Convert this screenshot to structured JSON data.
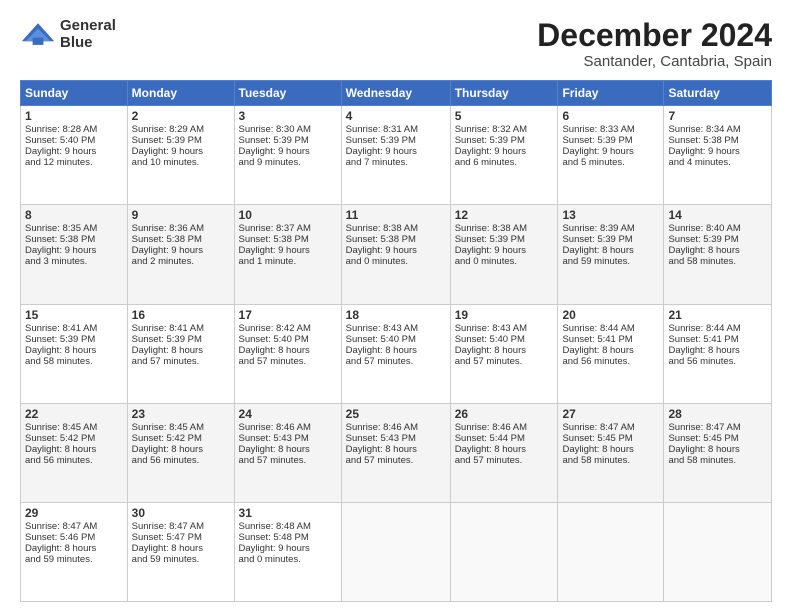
{
  "logo": {
    "name": "General",
    "name2": "Blue"
  },
  "header": {
    "title": "December 2024",
    "subtitle": "Santander, Cantabria, Spain"
  },
  "weekdays": [
    "Sunday",
    "Monday",
    "Tuesday",
    "Wednesday",
    "Thursday",
    "Friday",
    "Saturday"
  ],
  "weeks": [
    [
      {
        "day": "1",
        "lines": [
          "Sunrise: 8:28 AM",
          "Sunset: 5:40 PM",
          "Daylight: 9 hours",
          "and 12 minutes."
        ]
      },
      {
        "day": "2",
        "lines": [
          "Sunrise: 8:29 AM",
          "Sunset: 5:39 PM",
          "Daylight: 9 hours",
          "and 10 minutes."
        ]
      },
      {
        "day": "3",
        "lines": [
          "Sunrise: 8:30 AM",
          "Sunset: 5:39 PM",
          "Daylight: 9 hours",
          "and 9 minutes."
        ]
      },
      {
        "day": "4",
        "lines": [
          "Sunrise: 8:31 AM",
          "Sunset: 5:39 PM",
          "Daylight: 9 hours",
          "and 7 minutes."
        ]
      },
      {
        "day": "5",
        "lines": [
          "Sunrise: 8:32 AM",
          "Sunset: 5:39 PM",
          "Daylight: 9 hours",
          "and 6 minutes."
        ]
      },
      {
        "day": "6",
        "lines": [
          "Sunrise: 8:33 AM",
          "Sunset: 5:39 PM",
          "Daylight: 9 hours",
          "and 5 minutes."
        ]
      },
      {
        "day": "7",
        "lines": [
          "Sunrise: 8:34 AM",
          "Sunset: 5:38 PM",
          "Daylight: 9 hours",
          "and 4 minutes."
        ]
      }
    ],
    [
      {
        "day": "8",
        "lines": [
          "Sunrise: 8:35 AM",
          "Sunset: 5:38 PM",
          "Daylight: 9 hours",
          "and 3 minutes."
        ]
      },
      {
        "day": "9",
        "lines": [
          "Sunrise: 8:36 AM",
          "Sunset: 5:38 PM",
          "Daylight: 9 hours",
          "and 2 minutes."
        ]
      },
      {
        "day": "10",
        "lines": [
          "Sunrise: 8:37 AM",
          "Sunset: 5:38 PM",
          "Daylight: 9 hours",
          "and 1 minute."
        ]
      },
      {
        "day": "11",
        "lines": [
          "Sunrise: 8:38 AM",
          "Sunset: 5:38 PM",
          "Daylight: 9 hours",
          "and 0 minutes."
        ]
      },
      {
        "day": "12",
        "lines": [
          "Sunrise: 8:38 AM",
          "Sunset: 5:39 PM",
          "Daylight: 9 hours",
          "and 0 minutes."
        ]
      },
      {
        "day": "13",
        "lines": [
          "Sunrise: 8:39 AM",
          "Sunset: 5:39 PM",
          "Daylight: 8 hours",
          "and 59 minutes."
        ]
      },
      {
        "day": "14",
        "lines": [
          "Sunrise: 8:40 AM",
          "Sunset: 5:39 PM",
          "Daylight: 8 hours",
          "and 58 minutes."
        ]
      }
    ],
    [
      {
        "day": "15",
        "lines": [
          "Sunrise: 8:41 AM",
          "Sunset: 5:39 PM",
          "Daylight: 8 hours",
          "and 58 minutes."
        ]
      },
      {
        "day": "16",
        "lines": [
          "Sunrise: 8:41 AM",
          "Sunset: 5:39 PM",
          "Daylight: 8 hours",
          "and 57 minutes."
        ]
      },
      {
        "day": "17",
        "lines": [
          "Sunrise: 8:42 AM",
          "Sunset: 5:40 PM",
          "Daylight: 8 hours",
          "and 57 minutes."
        ]
      },
      {
        "day": "18",
        "lines": [
          "Sunrise: 8:43 AM",
          "Sunset: 5:40 PM",
          "Daylight: 8 hours",
          "and 57 minutes."
        ]
      },
      {
        "day": "19",
        "lines": [
          "Sunrise: 8:43 AM",
          "Sunset: 5:40 PM",
          "Daylight: 8 hours",
          "and 57 minutes."
        ]
      },
      {
        "day": "20",
        "lines": [
          "Sunrise: 8:44 AM",
          "Sunset: 5:41 PM",
          "Daylight: 8 hours",
          "and 56 minutes."
        ]
      },
      {
        "day": "21",
        "lines": [
          "Sunrise: 8:44 AM",
          "Sunset: 5:41 PM",
          "Daylight: 8 hours",
          "and 56 minutes."
        ]
      }
    ],
    [
      {
        "day": "22",
        "lines": [
          "Sunrise: 8:45 AM",
          "Sunset: 5:42 PM",
          "Daylight: 8 hours",
          "and 56 minutes."
        ]
      },
      {
        "day": "23",
        "lines": [
          "Sunrise: 8:45 AM",
          "Sunset: 5:42 PM",
          "Daylight: 8 hours",
          "and 56 minutes."
        ]
      },
      {
        "day": "24",
        "lines": [
          "Sunrise: 8:46 AM",
          "Sunset: 5:43 PM",
          "Daylight: 8 hours",
          "and 57 minutes."
        ]
      },
      {
        "day": "25",
        "lines": [
          "Sunrise: 8:46 AM",
          "Sunset: 5:43 PM",
          "Daylight: 8 hours",
          "and 57 minutes."
        ]
      },
      {
        "day": "26",
        "lines": [
          "Sunrise: 8:46 AM",
          "Sunset: 5:44 PM",
          "Daylight: 8 hours",
          "and 57 minutes."
        ]
      },
      {
        "day": "27",
        "lines": [
          "Sunrise: 8:47 AM",
          "Sunset: 5:45 PM",
          "Daylight: 8 hours",
          "and 58 minutes."
        ]
      },
      {
        "day": "28",
        "lines": [
          "Sunrise: 8:47 AM",
          "Sunset: 5:45 PM",
          "Daylight: 8 hours",
          "and 58 minutes."
        ]
      }
    ],
    [
      {
        "day": "29",
        "lines": [
          "Sunrise: 8:47 AM",
          "Sunset: 5:46 PM",
          "Daylight: 8 hours",
          "and 59 minutes."
        ]
      },
      {
        "day": "30",
        "lines": [
          "Sunrise: 8:47 AM",
          "Sunset: 5:47 PM",
          "Daylight: 8 hours",
          "and 59 minutes."
        ]
      },
      {
        "day": "31",
        "lines": [
          "Sunrise: 8:48 AM",
          "Sunset: 5:48 PM",
          "Daylight: 9 hours",
          "and 0 minutes."
        ]
      },
      null,
      null,
      null,
      null
    ]
  ]
}
